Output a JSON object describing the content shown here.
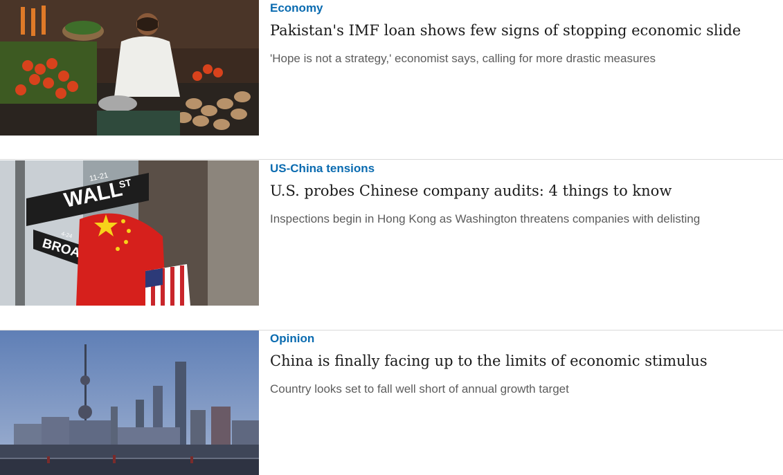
{
  "articles": [
    {
      "tag": "Economy",
      "headline": "Pakistan's IMF loan shows few signs of stopping economic slide",
      "summary": "'Hope is not a strategy,' economist says, calling for more drastic measures",
      "image": "market-vendor-photo"
    },
    {
      "tag": "US-China tensions",
      "headline": "U.S. probes Chinese company audits: 4 things to know",
      "summary": "Inspections begin in Hong Kong as Washington threatens companies with delisting",
      "image": "wall-street-flags-photo",
      "sign_texts": {
        "street": "WALL",
        "st": "ST",
        "number": "11-21",
        "broad": "BROAD",
        "broad_number": "4-24"
      }
    },
    {
      "tag": "Opinion",
      "headline": "China is finally facing up to the limits of economic stimulus",
      "summary": "Country looks set to fall well short of annual growth target",
      "image": "shanghai-skyline-photo"
    }
  ]
}
